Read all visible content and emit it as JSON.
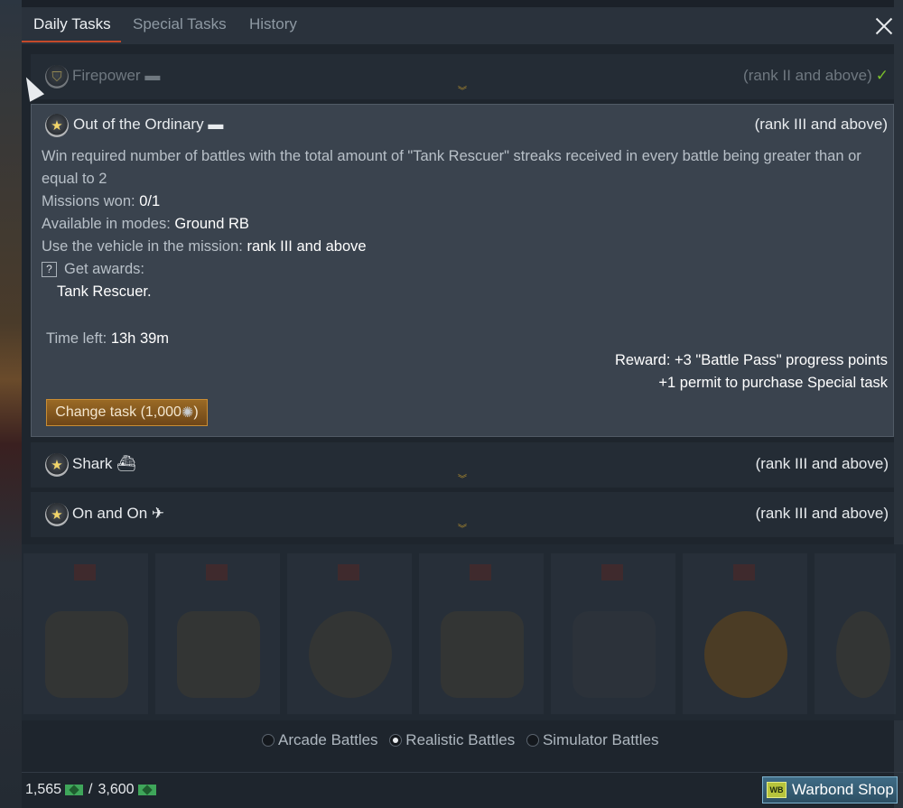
{
  "tabs": [
    {
      "label": "Daily Tasks"
    },
    {
      "label": "Special Tasks"
    },
    {
      "label": "History"
    }
  ],
  "tasks": {
    "firepower": {
      "name": "Firepower",
      "rank": "(rank II and above)"
    },
    "expanded": {
      "name": "Out of the Ordinary",
      "rank": "(rank III and above)",
      "description": "Win required number of battles with the total amount of \"Tank Rescuer\" streaks received in every battle being greater than or equal to 2",
      "missions_label": "Missions won: ",
      "missions_value": "0/1",
      "modes_label": "Available in modes: ",
      "modes_value": "Ground RB",
      "vehicle_label": "Use the vehicle in the mission: ",
      "vehicle_value": "rank III and above",
      "awards_label": "Get awards:",
      "awards_value": "Tank Rescuer.",
      "time_label": "Time left: ",
      "time_value": "13h 39m",
      "reward_line1": "Reward: +3 \"Battle Pass\" progress points",
      "reward_line2": "+1 permit to purchase Special task",
      "change_label": "Change task (1,000"
    },
    "shark": {
      "name": "Shark",
      "rank": "(rank III and above)"
    },
    "onandon": {
      "name": "On and On",
      "rank": "(rank III and above)"
    }
  },
  "modes": [
    {
      "label": "Arcade Battles",
      "selected": false
    },
    {
      "label": "Realistic Battles",
      "selected": true
    },
    {
      "label": "Simulator Battles",
      "selected": false
    }
  ],
  "footer": {
    "current": "1,565",
    "separator": "/",
    "max": "3,600",
    "shop_logo": "WB",
    "shop_label": "Warbond Shop"
  },
  "colors": {
    "accent_tab": "#c44a2a",
    "check": "#7bbf2b",
    "change_button": "#9a6a25",
    "shop_button": "#3f6c86"
  }
}
